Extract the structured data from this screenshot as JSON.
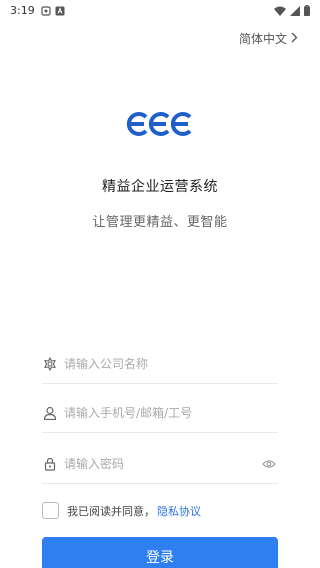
{
  "status_bar": {
    "time": "3:19",
    "icons": [
      "sync-icon",
      "notification-a-icon",
      "wifi-icon",
      "signal-icon",
      "battery-icon"
    ]
  },
  "language": {
    "label": "简体中文",
    "icon": "chevron-right-icon"
  },
  "logo": {
    "icon": "ecs-logo-icon",
    "color": "#1f5fc8"
  },
  "app": {
    "title": "精益企业运营系统",
    "subtitle": "让管理更精益、更智能"
  },
  "form": {
    "company": {
      "placeholder": "请输入公司名称",
      "value": "",
      "icon": "gear-flower-icon"
    },
    "account": {
      "placeholder": "请输入手机号/邮箱/工号",
      "value": "",
      "icon": "user-icon"
    },
    "password": {
      "placeholder": "请输入密码",
      "value": "",
      "icon": "lock-icon",
      "toggle_icon": "eye-icon"
    }
  },
  "agreement": {
    "checked": false,
    "text": "我已阅读并同意，",
    "link": "隐私协议"
  },
  "actions": {
    "login_label": "登录"
  },
  "colors": {
    "primary": "#2f7ff0",
    "link": "#2b74e8"
  }
}
